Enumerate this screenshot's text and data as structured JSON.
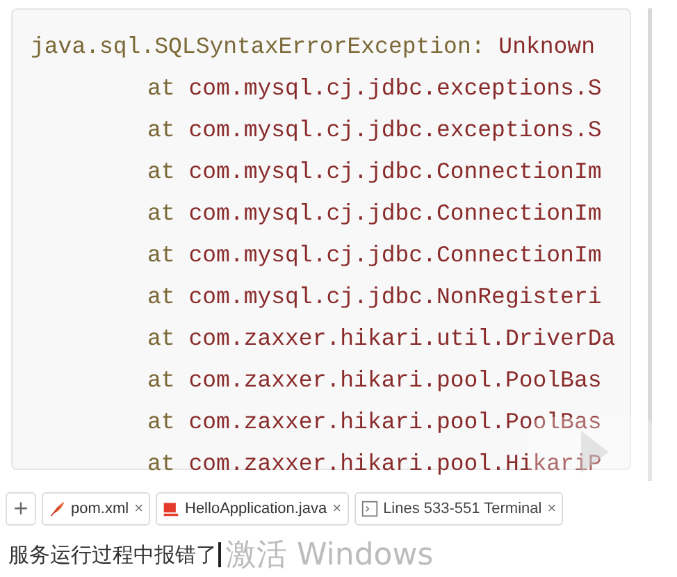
{
  "code_block": {
    "lines": [
      {
        "kind": "header",
        "keyword": "java.sql.SQLSyntaxErrorException:",
        "text": "Unknown"
      },
      {
        "kind": "frame",
        "keyword": "at",
        "text": "com.mysql.cj.jdbc.exceptions.S"
      },
      {
        "kind": "frame",
        "keyword": "at",
        "text": "com.mysql.cj.jdbc.exceptions.S"
      },
      {
        "kind": "frame",
        "keyword": "at",
        "text": "com.mysql.cj.jdbc.ConnectionIm"
      },
      {
        "kind": "frame",
        "keyword": "at",
        "text": "com.mysql.cj.jdbc.ConnectionIm"
      },
      {
        "kind": "frame",
        "keyword": "at",
        "text": "com.mysql.cj.jdbc.ConnectionIm"
      },
      {
        "kind": "frame",
        "keyword": "at",
        "text": "com.mysql.cj.jdbc.NonRegisteri"
      },
      {
        "kind": "frame",
        "keyword": "at",
        "text": "com.zaxxer.hikari.util.DriverDa"
      },
      {
        "kind": "frame",
        "keyword": "at",
        "text": "com.zaxxer.hikari.pool.PoolBas"
      },
      {
        "kind": "frame",
        "keyword": "at",
        "text": "com.zaxxer.hikari.pool.PoolBas"
      },
      {
        "kind": "frame",
        "keyword": "at",
        "text": "com.zaxxer.hikari.pool.HikariP"
      }
    ]
  },
  "tab_bar": {
    "add_button": "+",
    "tabs": [
      {
        "kind": "feather",
        "label": "pom.xml",
        "close": "×"
      },
      {
        "kind": "cup",
        "label": "HelloApplication.java",
        "close": "×"
      },
      {
        "kind": "terminal",
        "label": "Lines 533-551 Terminal",
        "close": "×"
      }
    ]
  },
  "message_input": {
    "value": "服务运行过程中报错了"
  },
  "os_overlay": {
    "text": "激活 Windows"
  }
}
